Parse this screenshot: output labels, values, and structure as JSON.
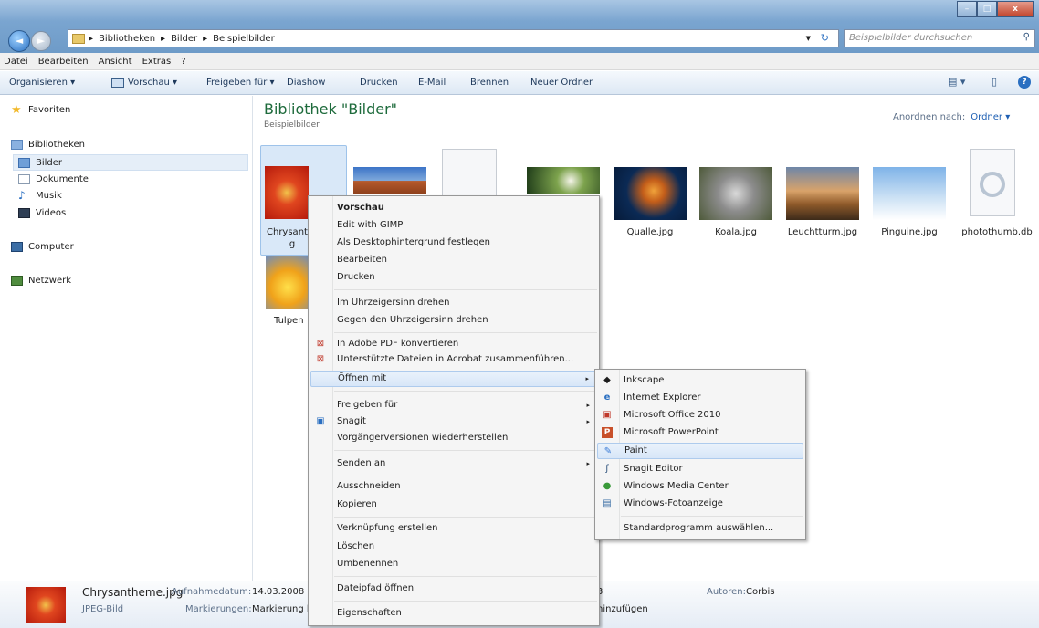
{
  "window": {
    "min": "–",
    "max": "□",
    "close": "x"
  },
  "address": {
    "crumbs": [
      "Bibliotheken",
      "Bilder",
      "Beispielbilder"
    ],
    "sep": "▸",
    "search_placeholder": "Beispielbilder durchsuchen"
  },
  "menubar": [
    "Datei",
    "Bearbeiten",
    "Ansicht",
    "Extras",
    "?"
  ],
  "cmdbar": {
    "organize": "Organisieren ▾",
    "preview": "Vorschau ▾",
    "share": "Freigeben für ▾",
    "slideshow": "Diashow",
    "print": "Drucken",
    "email": "E-Mail",
    "burn": "Brennen",
    "new_folder": "Neuer Ordner"
  },
  "sidebar": {
    "favorites": "Favoriten",
    "libraries": "Bibliotheken",
    "pictures": "Bilder",
    "documents": "Dokumente",
    "music": "Musik",
    "videos": "Videos",
    "computer": "Computer",
    "network": "Netzwerk"
  },
  "library": {
    "title": "Bibliothek \"Bilder\"",
    "subtitle": "Beispielbilder",
    "arrange_label": "Anordnen nach:",
    "arrange_value": "Ordner ▾"
  },
  "files": {
    "chrys1": "Chrysanth",
    "chrys2": "g",
    "qualle": "Qualle.jpg",
    "koala": "Koala.jpg",
    "leucht": "Leuchtturm.jpg",
    "pinguine": "Pinguine.jpg",
    "thumbs": "photothumb.db",
    "tulpen": "Tulpen"
  },
  "details": {
    "name": "Chrysantheme.jpg",
    "date_label": "Aufnahmedatum:",
    "date_value": "14.03.2008 13",
    "type": "JPEG-Bild",
    "tags_label": "Markierungen:",
    "tags_value": "Markierung h",
    "trail": "hinzufügen",
    "authors_label": "Autoren:",
    "authors_value": "Corbis",
    "frag": "3"
  },
  "context_menu": {
    "preview": "Vorschau",
    "gimp": "Edit with GIMP",
    "desktop": "Als Desktophintergrund festlegen",
    "edit": "Bearbeiten",
    "print": "Drucken",
    "rotate_cw": "Im Uhrzeigersinn drehen",
    "rotate_ccw": "Gegen den Uhrzeigersinn drehen",
    "pdf": "In Adobe PDF konvertieren",
    "acrobat": "Unterstützte Dateien in Acrobat zusammenführen...",
    "open_with": "Öffnen mit",
    "share": "Freigeben für",
    "snagit": "Snagit",
    "restore": "Vorgängerversionen wiederherstellen",
    "send_to": "Senden an",
    "cut": "Ausschneiden",
    "copy": "Kopieren",
    "shortcut": "Verknüpfung erstellen",
    "delete": "Löschen",
    "rename": "Umbenennen",
    "open_path": "Dateipfad öffnen",
    "properties": "Eigenschaften",
    "arrow": "▸"
  },
  "open_with_menu": {
    "inkscape": "Inkscape",
    "ie": "Internet Explorer",
    "office": "Microsoft Office 2010",
    "powerpoint": "Microsoft PowerPoint",
    "paint": "Paint",
    "snagit_editor": "Snagit Editor",
    "wmc": "Windows Media Center",
    "photo_viewer": "Windows-Fotoanzeige",
    "choose_default": "Standardprogramm auswählen..."
  }
}
